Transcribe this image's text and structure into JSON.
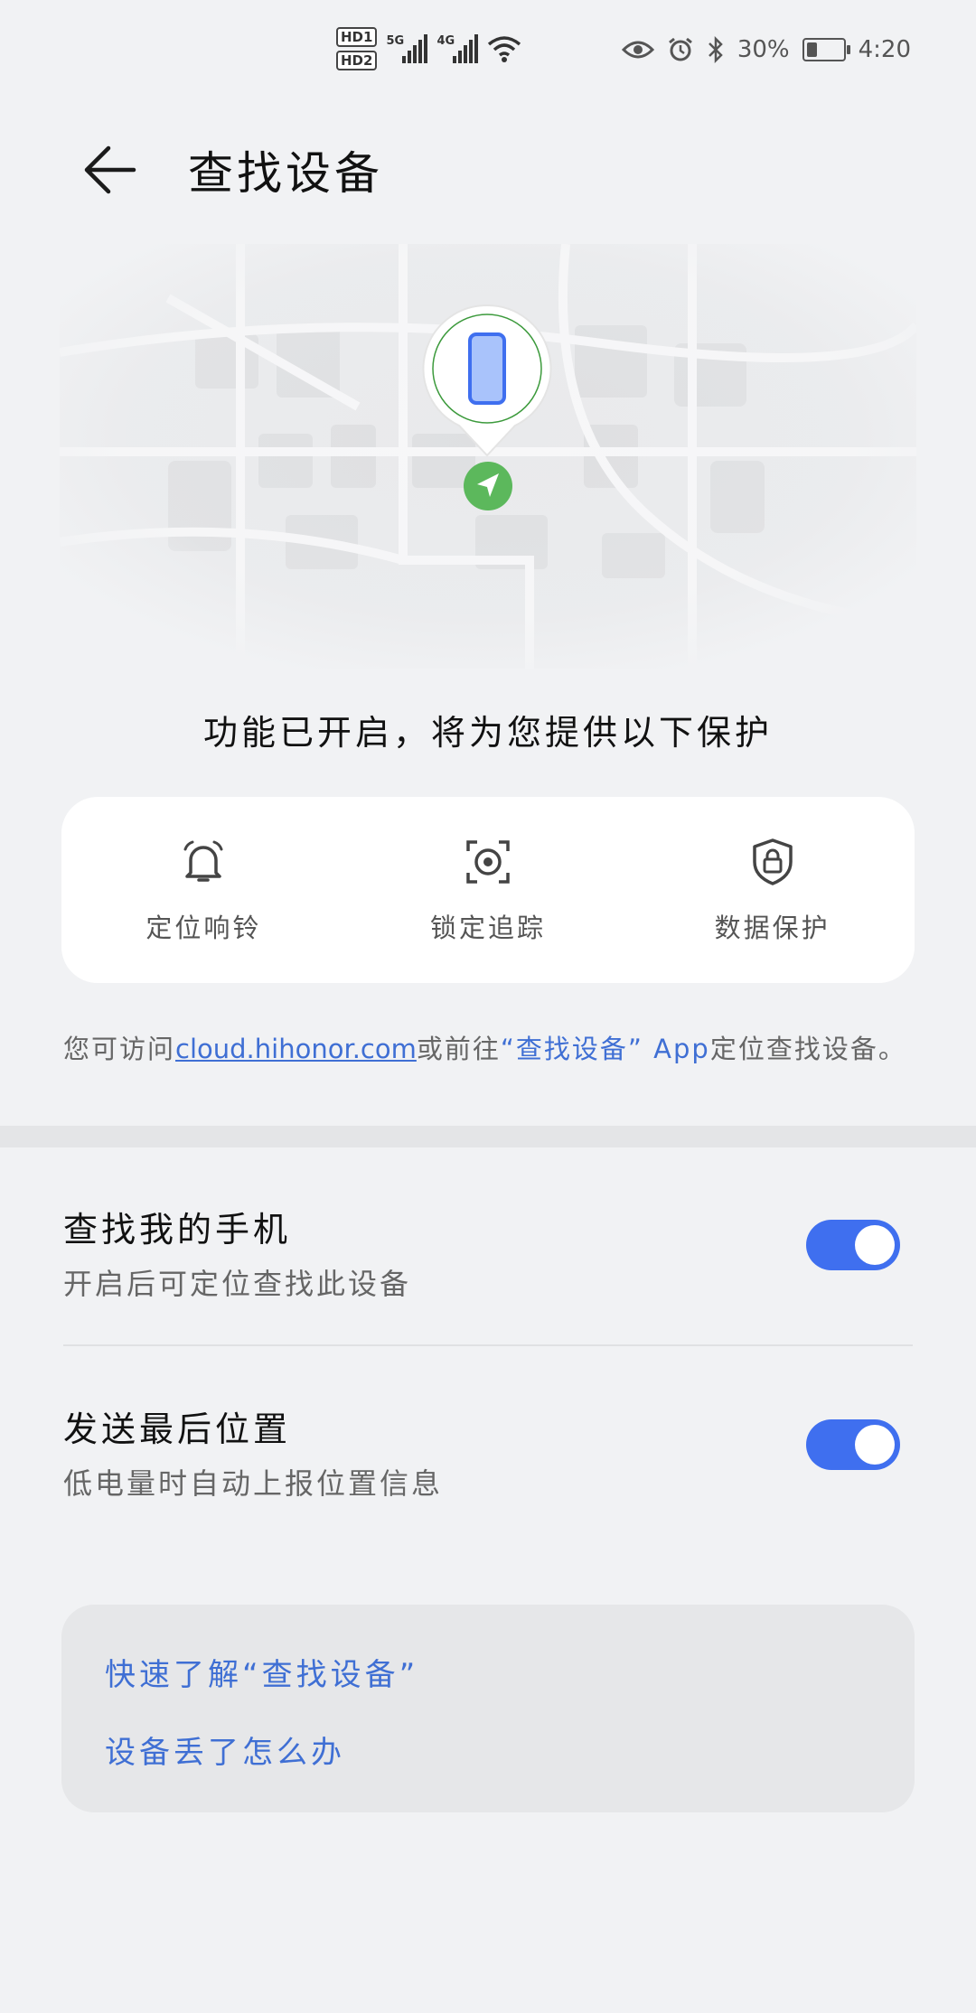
{
  "status_bar": {
    "hd1": "HD1",
    "hd2": "HD2",
    "sig1_label": "5G",
    "sig2_label": "4G",
    "battery_percent": "30%",
    "battery_level": 0.3,
    "time": "4:20",
    "icons": [
      "eye-icon",
      "alarm-icon",
      "bluetooth-icon",
      "wifi-icon"
    ]
  },
  "header": {
    "title": "查找设备",
    "back_icon": "arrow-left-icon"
  },
  "intro": "功能已开启，将为您提供以下保护",
  "features": [
    {
      "label": "定位响铃",
      "icon": "bell-icon"
    },
    {
      "label": "锁定追踪",
      "icon": "target-lock-icon"
    },
    {
      "label": "数据保护",
      "icon": "shield-lock-icon"
    }
  ],
  "hint": {
    "prefix": "您可访问",
    "link": "cloud.hihonor.com",
    "middle": "或前往",
    "app_name": "“查找设备” App",
    "suffix": "定位查找设备。"
  },
  "settings": [
    {
      "title": "查找我的手机",
      "subtitle": "开启后可定位查找此设备",
      "enabled": true
    },
    {
      "title": "发送最后位置",
      "subtitle": "低电量时自动上报位置信息",
      "enabled": true
    }
  ],
  "help": {
    "items": [
      "快速了解“查找设备”",
      "设备丢了怎么办"
    ]
  },
  "colors": {
    "accent": "#3f6fef",
    "link": "#3f6fd4",
    "background": "#f1f2f4",
    "location_green": "#5cb85c"
  }
}
